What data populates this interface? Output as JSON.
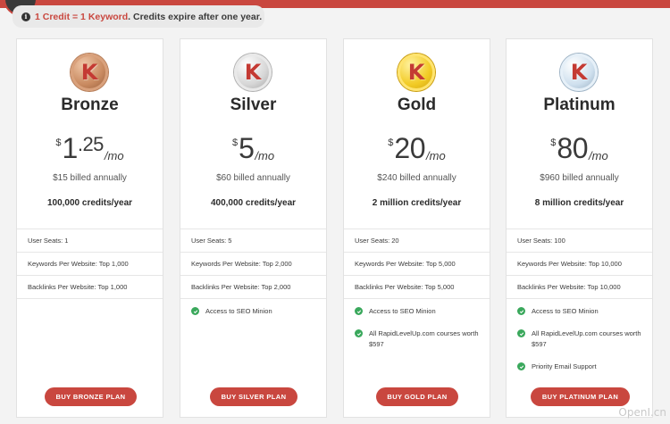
{
  "notice": {
    "highlight": "1 Credit = 1 Keyword",
    "rest": ". Credits expire after one year."
  },
  "plans": [
    {
      "name": "Bronze",
      "medal_letter": "K",
      "currency": "$",
      "price_whole": "1",
      "price_fraction": ".25",
      "per": "/mo",
      "billed": "$15 billed annually",
      "credits": "100,000 credits/year",
      "seats": "User Seats: 1",
      "keywords": "Keywords Per Website: Top 1,000",
      "backlinks": "Backlinks Per Website: Top 1,000",
      "checks": [],
      "button": "BUY BRONZE PLAN"
    },
    {
      "name": "Silver",
      "medal_letter": "K",
      "currency": "$",
      "price_whole": "5",
      "per": "/mo",
      "billed": "$60 billed annually",
      "credits": "400,000 credits/year",
      "seats": "User Seats: 5",
      "keywords": "Keywords Per Website: Top 2,000",
      "backlinks": "Backlinks Per Website: Top 2,000",
      "checks": [
        "Access to SEO Minion"
      ],
      "button": "BUY SILVER PLAN"
    },
    {
      "name": "Gold",
      "medal_letter": "K",
      "currency": "$",
      "price_whole": "20",
      "per": "/mo",
      "billed": "$240 billed annually",
      "credits": "2 million credits/year",
      "seats": "User Seats: 20",
      "keywords": "Keywords Per Website: Top 5,000",
      "backlinks": "Backlinks Per Website: Top 5,000",
      "checks": [
        "Access to SEO Minion",
        "All RapidLevelUp.com courses worth $597"
      ],
      "button": "BUY GOLD PLAN"
    },
    {
      "name": "Platinum",
      "medal_letter": "K",
      "currency": "$",
      "price_whole": "80",
      "per": "/mo",
      "billed": "$960 billed annually",
      "credits": "8 million credits/year",
      "seats": "User Seats: 100",
      "keywords": "Keywords Per Website: Top 10,000",
      "backlinks": "Backlinks Per Website: Top 10,000",
      "checks": [
        "Access to SEO Minion",
        "All RapidLevelUp.com courses worth $597",
        "Priority Email Support"
      ],
      "button": "BUY PLATINUM PLAN"
    }
  ],
  "colors": {
    "accent": "#c9473f",
    "check": "#3aa85c"
  },
  "watermark": "OpenI.cn"
}
